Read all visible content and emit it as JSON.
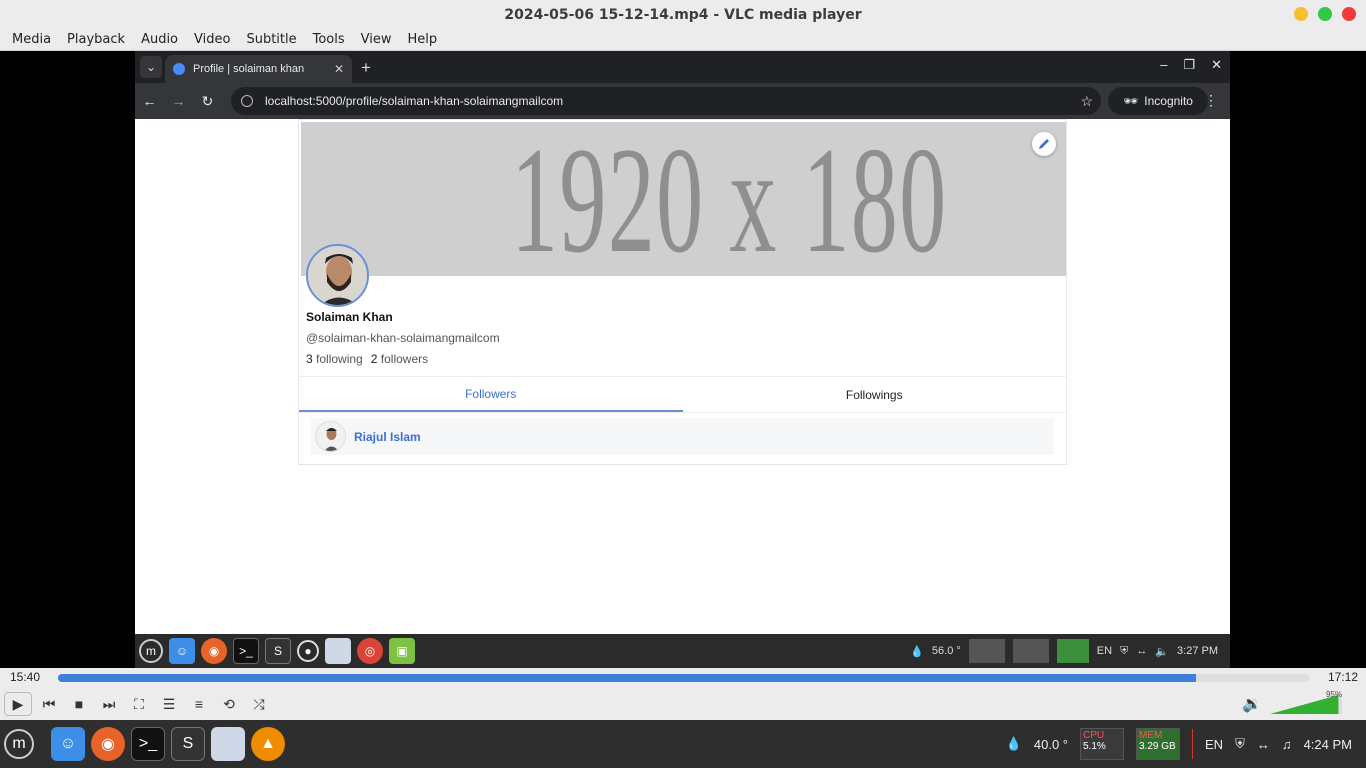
{
  "vlc": {
    "title": "2024-05-06 15-12-14.mp4 - VLC media player",
    "menu": [
      "Media",
      "Playback",
      "Audio",
      "Video",
      "Subtitle",
      "Tools",
      "View",
      "Help"
    ],
    "time_elapsed": "15:40",
    "time_total": "17:12",
    "progress": 0.91,
    "volume_label": "95%",
    "volume": 0.95
  },
  "browser": {
    "tab_title": "Profile | solaiman khan",
    "url": "localhost:5000/profile/solaiman-khan-solaimangmailcom",
    "incognito_label": "Incognito"
  },
  "profile": {
    "banner_text": "1920 x 180",
    "name": "Solaiman Khan",
    "handle": "@solaiman-khan-solaimangmailcom",
    "following_count": "3",
    "following_label": "following",
    "followers_count": "2",
    "followers_label": "followers",
    "tabs": [
      "Followers",
      "Followings"
    ],
    "active_tab": "Followers",
    "followers": [
      {
        "name": "Riajul Islam"
      }
    ]
  },
  "inner_taskbar": {
    "temp": "56.0 °",
    "lang": "EN",
    "clock": "3:27 PM"
  },
  "bottom_taskbar": {
    "temp": "40.0 °",
    "cpu_label": "CPU",
    "cpu_value": "5.1%",
    "mem_label": "MEM",
    "mem_value": "3.29 GB",
    "lang": "EN",
    "clock": "4:24 PM"
  },
  "colors": {
    "accent": "#3b6fd4",
    "seek": "#3d7fd9",
    "vlc_orange": "#f08c00"
  }
}
